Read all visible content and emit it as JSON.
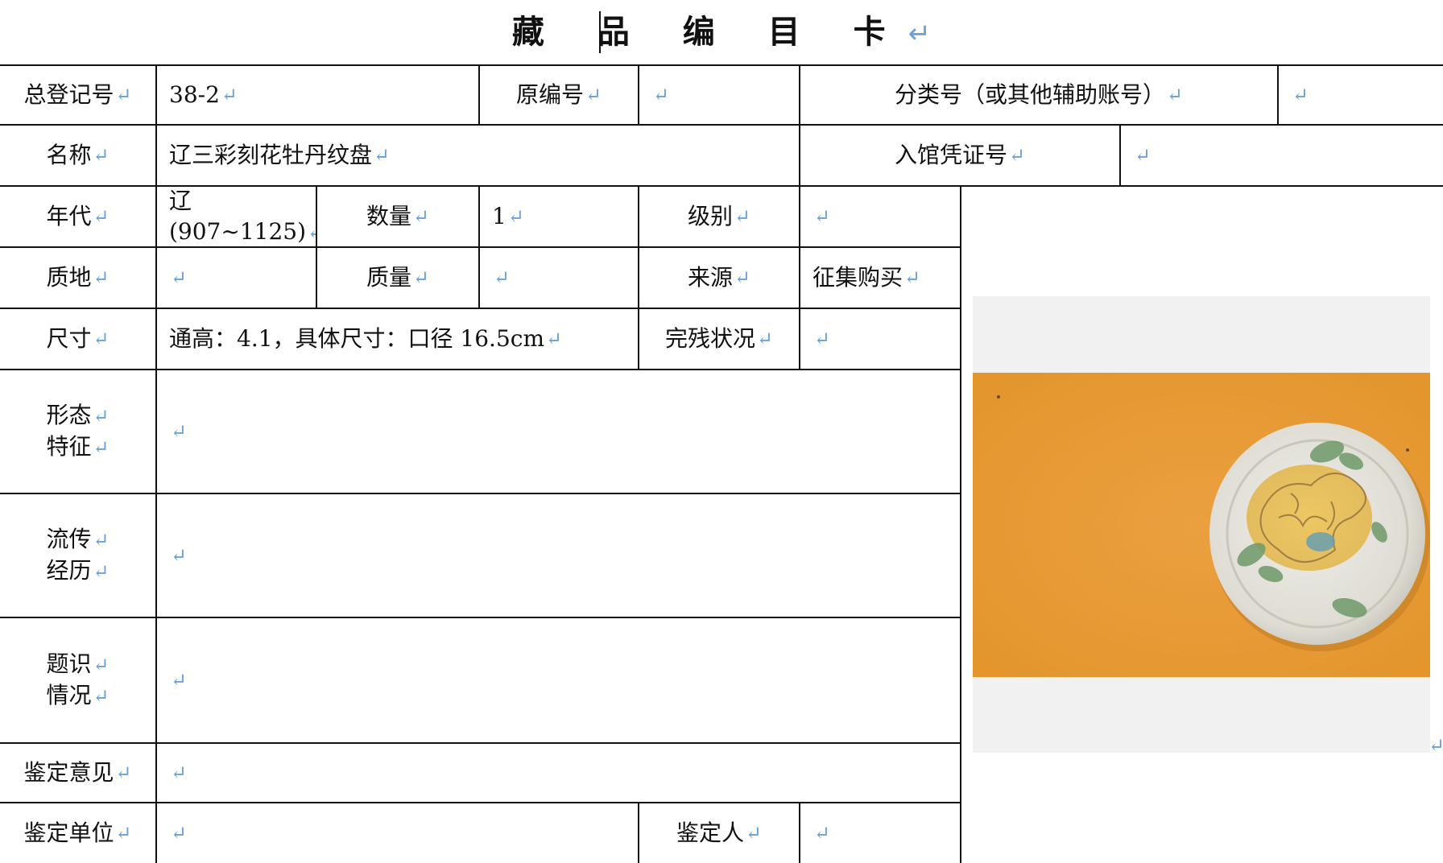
{
  "title": "藏 品 编 目 卡",
  "para_mark": "↵",
  "fields": {
    "total_reg_label": "总登记号",
    "total_reg_value": "38-2",
    "orig_no_label": "原编号",
    "orig_no_value": "",
    "class_no_label": "分类号（或其他辅助账号）",
    "class_no_value": "",
    "name_label": "名称",
    "name_value": "辽三彩刻花牡丹纹盘",
    "voucher_label": "入馆凭证号",
    "voucher_value": "",
    "era_label": "年代",
    "era_value_line1": "辽",
    "era_value_line2": "(907~1125)",
    "qty_label": "数量",
    "qty_value": "1",
    "grade_label": "级别",
    "grade_value": "",
    "material_label": "质地",
    "material_value": "",
    "weight_label": "质量",
    "weight_value": "",
    "source_label": "来源",
    "source_value": "征集购买",
    "size_label": "尺寸",
    "size_value": "通高：4.1，具体尺寸：口径 16.5cm",
    "condition_label": "完残状况",
    "condition_value": "",
    "form_label_1": "形态",
    "form_label_2": "特征",
    "form_value": "",
    "history_label_1": "流传",
    "history_label_2": "经历",
    "history_value": "",
    "inscription_label_1": "题识",
    "inscription_label_2": "情况",
    "inscription_value": "",
    "opinion_label": "鉴定意见",
    "opinion_value": "",
    "unit_label": "鉴定单位",
    "unit_value": "",
    "appraiser_label": "鉴定人",
    "appraiser_value": ""
  },
  "colors": {
    "line": "#111111",
    "paragraph_mark": "#6aa1d8",
    "photo_bg": "#f1f1f1",
    "photo_orange": "#e89c33"
  },
  "photo": {
    "alt": "辽三彩刻花牡丹纹盘"
  }
}
